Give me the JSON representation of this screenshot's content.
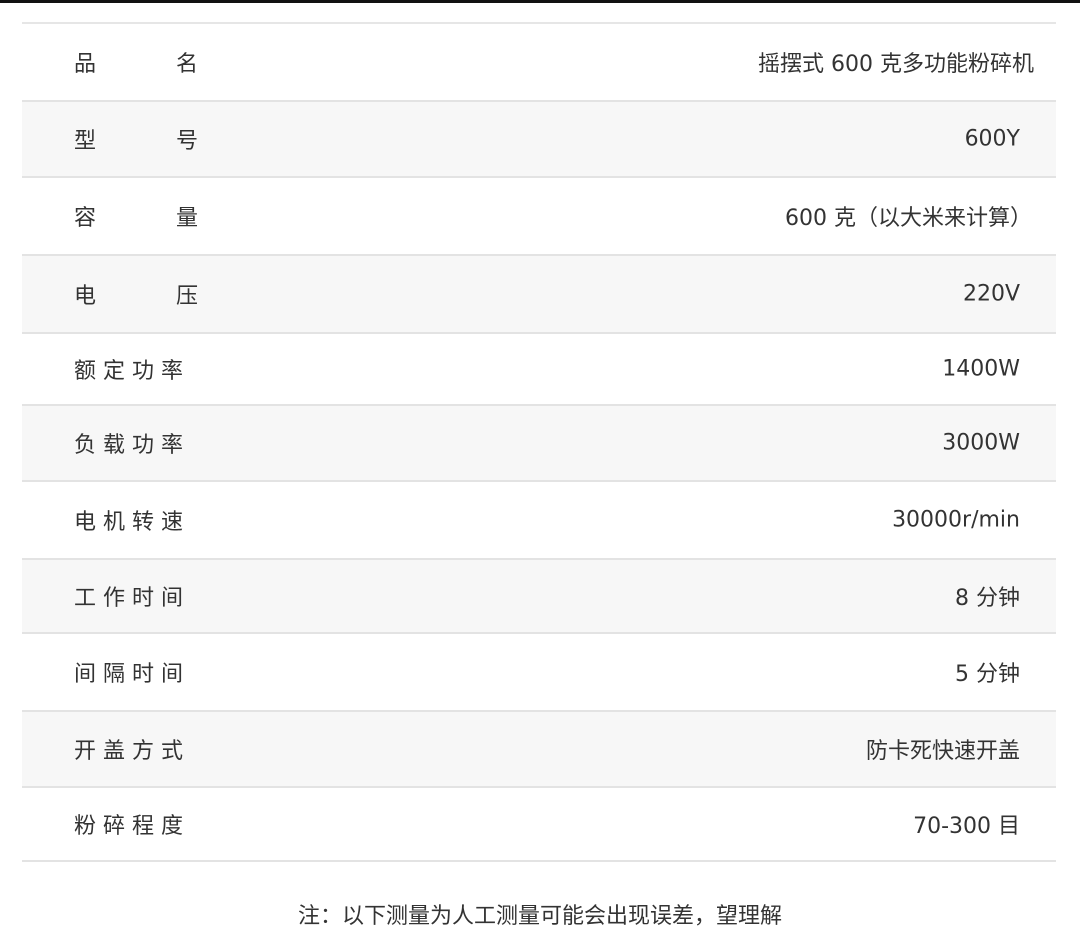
{
  "specs": [
    {
      "label": "品名",
      "label_chars": [
        "品",
        "名"
      ],
      "value": "摇摆式 600 克多功能粉碎机"
    },
    {
      "label": "型号",
      "label_chars": [
        "型",
        "号"
      ],
      "value": "600Y"
    },
    {
      "label": "容量",
      "label_chars": [
        "容",
        "量"
      ],
      "value": "600 克（以大米来计算）"
    },
    {
      "label": "电压",
      "label_chars": [
        "电",
        "压"
      ],
      "value": "220V"
    },
    {
      "label": "额定功率",
      "value": "1400W"
    },
    {
      "label": "负载功率",
      "value": "3000W"
    },
    {
      "label": "电机转速",
      "value": "30000r/min"
    },
    {
      "label": "工作时间",
      "value": "8 分钟"
    },
    {
      "label": "间隔时间",
      "value": "5 分钟"
    },
    {
      "label": "开盖方式",
      "value": "防卡死快速开盖"
    },
    {
      "label": "粉碎程度",
      "value": "70-300 目"
    }
  ],
  "note": "注：以下测量为人工测量可能会出现误差，望理解"
}
